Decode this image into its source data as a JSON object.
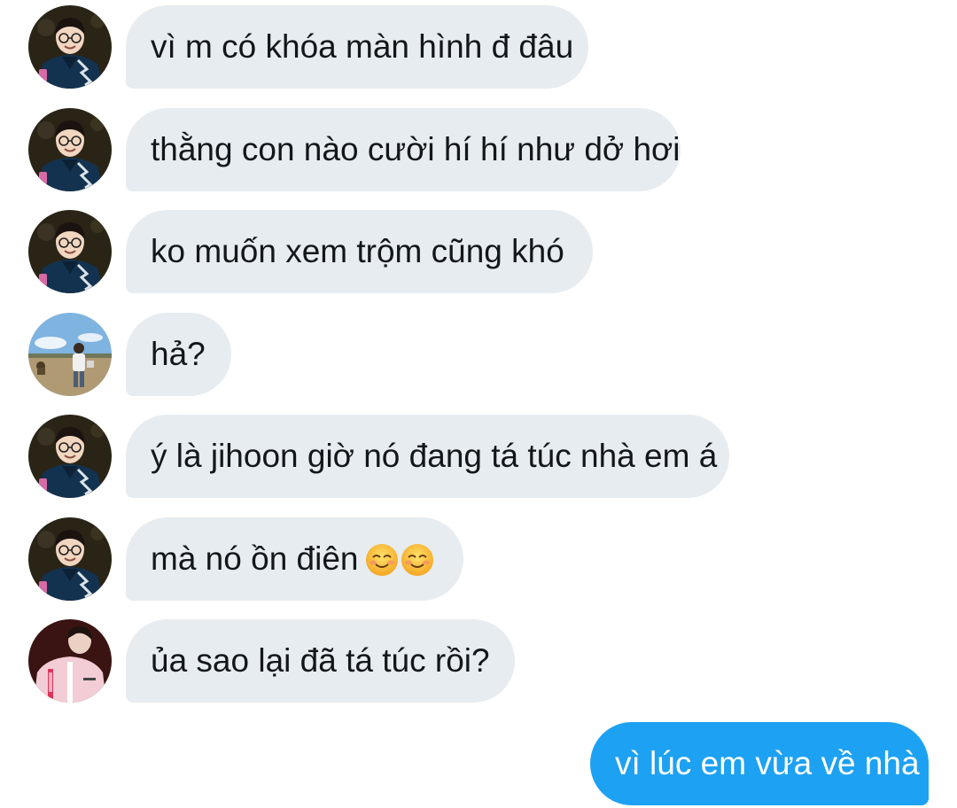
{
  "messages": [
    {
      "avatar": "avatar-a-icon",
      "text": "vì m có khóa màn hình đ đâu",
      "emoji_count": 0
    },
    {
      "avatar": "avatar-a-icon",
      "text": "thằng con nào cười hí hí như dở hơi",
      "emoji_count": 0
    },
    {
      "avatar": "avatar-a-icon",
      "text": "ko muốn xem trộm cũng khó",
      "emoji_count": 0
    },
    {
      "avatar": "avatar-b-icon",
      "text": "hả?",
      "emoji_count": 0
    },
    {
      "avatar": "avatar-a-icon",
      "text": "ý là jihoon giờ nó đang tá túc nhà em á",
      "emoji_count": 0
    },
    {
      "avatar": "avatar-a-icon",
      "text": "mà nó ồn điên",
      "emoji_count": 2,
      "emoji": "smiling-face-icon"
    },
    {
      "avatar": "avatar-c-icon",
      "text": "ủa sao lại đã tá túc rồi?",
      "emoji_count": 0
    }
  ],
  "own_message": {
    "text": "vì lúc em vừa về nhà"
  },
  "colors": {
    "incoming_bubble": "#e7ecf0",
    "outgoing_bubble": "#1da1f2",
    "incoming_text": "#14171a",
    "outgoing_text": "#ffffff"
  }
}
